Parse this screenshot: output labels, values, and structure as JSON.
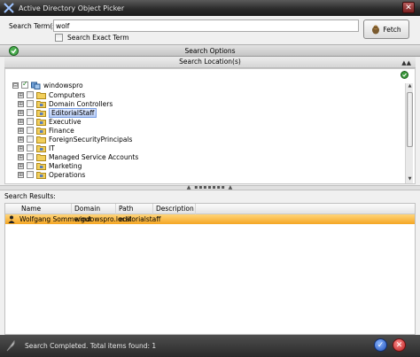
{
  "window": {
    "title": "Active Directory Object Picker",
    "close_glyph": "✕"
  },
  "search": {
    "term_label": "Search Term(s):",
    "term_value": "wolf",
    "exact_label": "Search Exact Term",
    "fetch_label": "Fetch"
  },
  "options": {
    "header": "Search Options",
    "location_header": "Search Location(s)",
    "collapse_glyph": "▲▲"
  },
  "tree": {
    "root": "windowspro",
    "items": [
      {
        "label": "Computers",
        "type": "folder"
      },
      {
        "label": "Domain Controllers",
        "type": "ou"
      },
      {
        "label": "EditorialStaff",
        "type": "ou",
        "selected": true
      },
      {
        "label": "Executive",
        "type": "ou"
      },
      {
        "label": "Finance",
        "type": "ou"
      },
      {
        "label": "ForeignSecurityPrincipals",
        "type": "folder"
      },
      {
        "label": "IT",
        "type": "ou"
      },
      {
        "label": "Managed Service Accounts",
        "type": "folder"
      },
      {
        "label": "Marketing",
        "type": "ou"
      },
      {
        "label": "Operations",
        "type": "ou"
      }
    ]
  },
  "splitter": {
    "glyph": "▲ ▪▪▪▪▪▪▪ ▲"
  },
  "results": {
    "label": "Search Results:",
    "columns": [
      "Name",
      "Domain",
      "Path",
      "Description"
    ],
    "rows": [
      {
        "name": "Wolfgang Sommergut",
        "domain": "windowspro.local",
        "path": "editorialstaff",
        "description": ""
      }
    ]
  },
  "status": {
    "message": "Search Completed. Total items found: 1",
    "ok_glyph": "✓",
    "cancel_glyph": "✕"
  },
  "icons": {
    "tree_expander": "⊞",
    "root_expander": "⊟"
  },
  "colors": {
    "titlebar": "#2c2c2c",
    "selection": "#b8ccf5",
    "result_row": "#f5a623",
    "ok_button": "#1f4fb8",
    "cancel_button": "#b81f1f"
  }
}
